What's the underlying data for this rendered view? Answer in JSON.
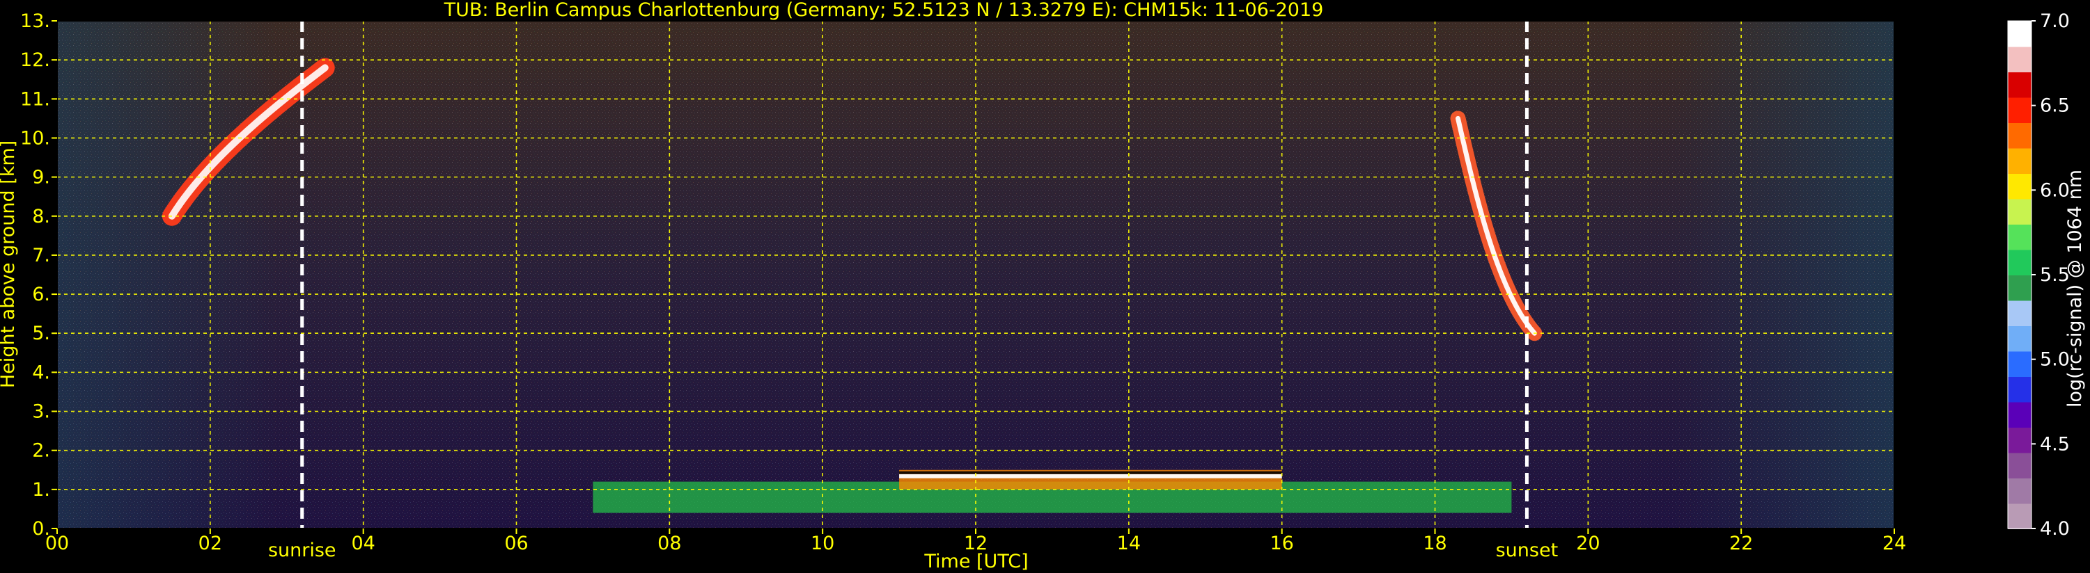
{
  "chart_data": {
    "type": "heatmap",
    "title": "TUB: Berlin Campus Charlottenburg (Germany; 52.5123 N / 13.3279 E):    CHM15k: 11-06-2019",
    "xlabel": "Time [UTC]",
    "ylabel": "Height above ground [km]",
    "xlim": [
      0,
      24
    ],
    "ylim": [
      0,
      13
    ],
    "x_ticks": [
      "00",
      "02",
      "04",
      "06",
      "08",
      "10",
      "12",
      "14",
      "16",
      "18",
      "20",
      "22",
      "24"
    ],
    "y_ticks": [
      "0.",
      "1.",
      "2.",
      "3.",
      "4.",
      "5.",
      "6.",
      "7.",
      "8.",
      "9.",
      "10.",
      "11.",
      "12.",
      "13."
    ],
    "grid": true,
    "annotations": [
      {
        "text": "sunrise",
        "x": 3.2
      },
      {
        "text": "sunset",
        "x": 19.2
      }
    ],
    "colorbar": {
      "label": "log(rc-signal) @ 1064 nm",
      "range": [
        4.0,
        7.0
      ],
      "ticks": [
        "4.0",
        "4.5",
        "5.0",
        "5.5",
        "6.0",
        "6.5",
        "7.0"
      ]
    },
    "features": [
      {
        "x_start": 1.5,
        "x_end": 3.5,
        "y_start": 8.0,
        "y_end": 11.8
      },
      {
        "x_start": 18.3,
        "x_end": 19.3,
        "y_start": 5.0,
        "y_end": 10.5
      },
      {
        "x_start": 11.0,
        "x_end": 16.0,
        "y_start": 1.0,
        "y_end": 1.5
      },
      {
        "x_start": 7.0,
        "x_end": 19.0,
        "y_start": 0.4,
        "y_end": 1.2
      }
    ]
  },
  "colors": {
    "text": "#ffff00",
    "grid": "#ffff00",
    "background_high": "#3b2a24",
    "background_low": "#1f1240",
    "boundary_layer": "#22c54a",
    "cloud": "#ffffff",
    "marker": "#ffffff"
  },
  "colorbar_colors": [
    "#b99bb5",
    "#a07aa6",
    "#8a4f98",
    "#7a1a9a",
    "#5a00b8",
    "#2530e8",
    "#2a6cff",
    "#70aef7",
    "#a8c8f6",
    "#2f9f4f",
    "#21c95b",
    "#55e25a",
    "#c8f34f",
    "#ffe800",
    "#ffb100",
    "#ff6a00",
    "#ff1f00",
    "#d90000",
    "#f3c0c0",
    "#ffffff"
  ]
}
